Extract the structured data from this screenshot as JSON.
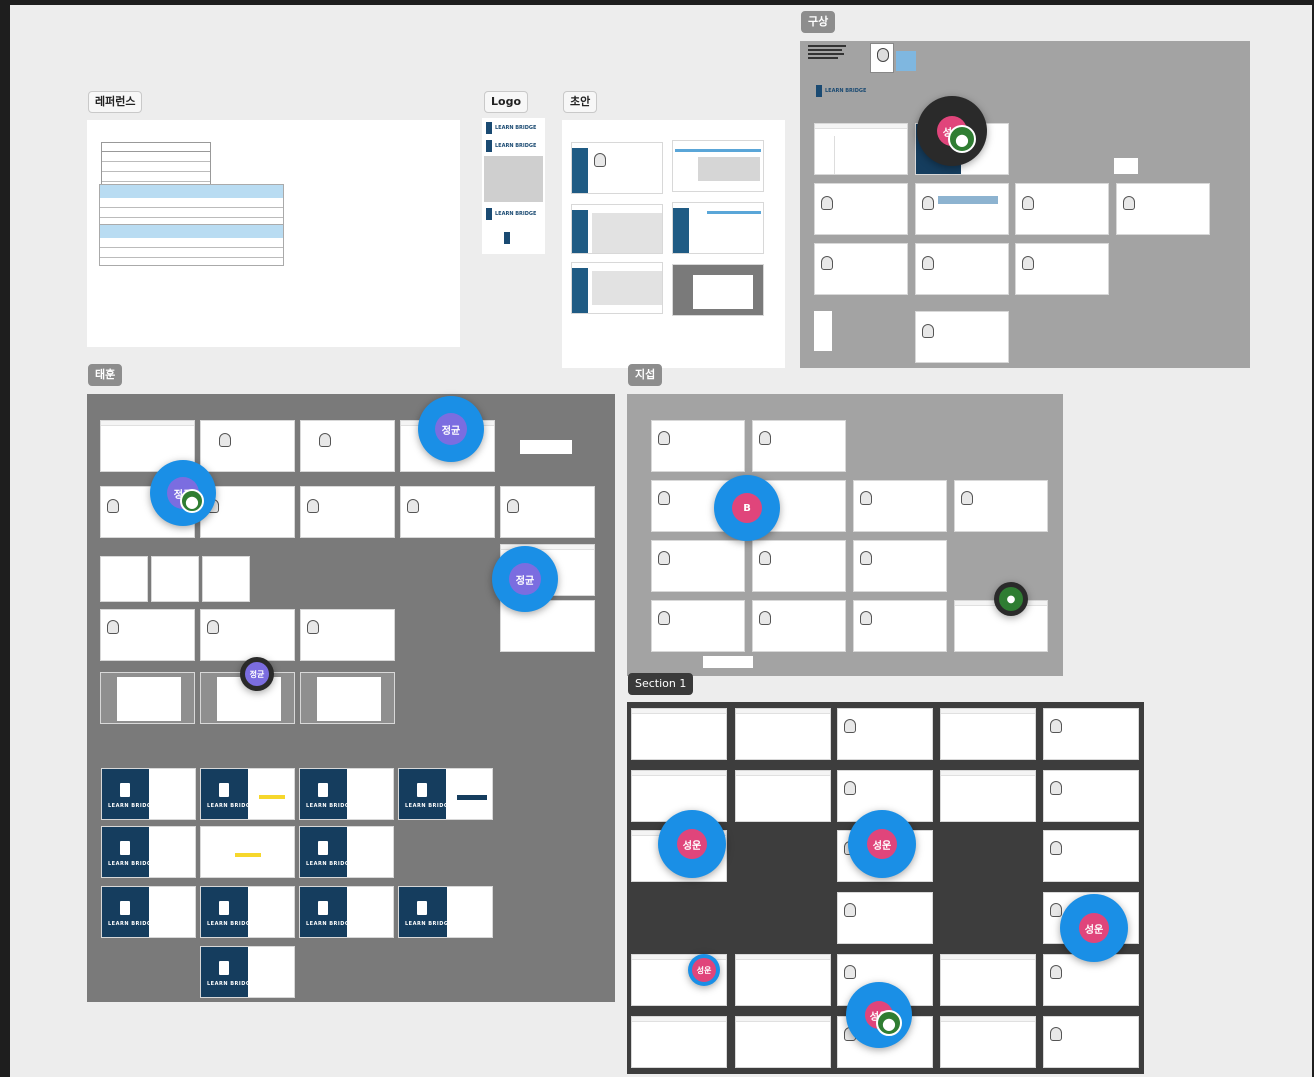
{
  "sections": {
    "reference": {
      "title": "레퍼런스"
    },
    "logo": {
      "title": "Logo"
    },
    "draft": {
      "title": "초안"
    },
    "plan": {
      "title": "구상"
    },
    "taehun": {
      "title": "태훈"
    },
    "jiseop": {
      "title": "지섭"
    },
    "section1": {
      "title": "Section 1"
    }
  },
  "brand": {
    "name": "LEARN BRIDGE",
    "primary_color": "#153d5e",
    "accent_color": "#1a8fe6"
  },
  "cursors": [
    {
      "name": "성운",
      "style": "dark-badge",
      "color": "#e0457b"
    },
    {
      "name": "정균",
      "style": "blue-circle",
      "color": "#7b6de0"
    },
    {
      "name": "정균",
      "style": "blue-circle-with-avatar",
      "color": "#7b6de0"
    },
    {
      "name": "정균",
      "style": "blue-circle",
      "color": "#7b6de0"
    },
    {
      "name": "정균",
      "style": "dark-badge",
      "color": "#7b6de0"
    },
    {
      "name": "B",
      "style": "blue-circle",
      "color": "#e0457b"
    },
    {
      "name": "성운",
      "style": "blue-circle",
      "color": "#e0457b"
    },
    {
      "name": "성운",
      "style": "blue-circle",
      "color": "#e0457b"
    },
    {
      "name": "성운",
      "style": "blue-circle",
      "color": "#e0457b"
    },
    {
      "name": "성운",
      "style": "small",
      "color": "#e0457b"
    },
    {
      "name": "성운",
      "style": "blue-circle-with-avatar",
      "color": "#e0457b"
    }
  ]
}
